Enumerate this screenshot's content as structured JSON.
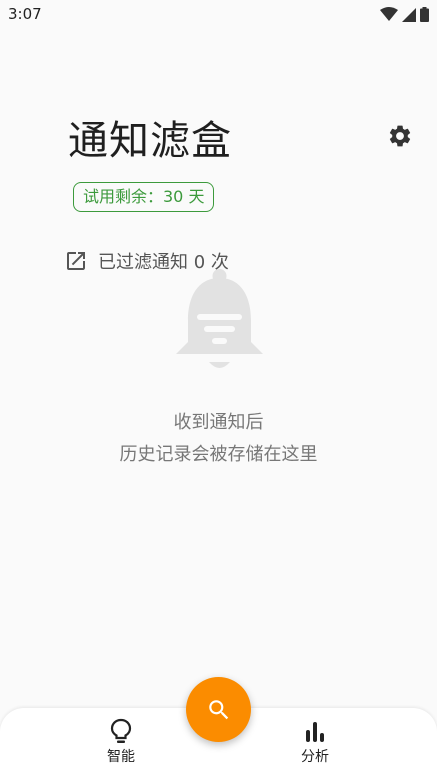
{
  "status_bar": {
    "time": "3:07",
    "icons": [
      "wifi-icon",
      "signal-icon",
      "battery-icon"
    ]
  },
  "header": {
    "title": "通知滤盒",
    "settings_icon": "gear-icon"
  },
  "trial": {
    "label": "试用剩余：30 天",
    "color": "#3c9a3c"
  },
  "filtered": {
    "text": "已过滤通知 0 次",
    "icon": "open-external-icon"
  },
  "empty_state": {
    "icon": "bell-filter-icon",
    "line1": "收到通知后",
    "line2": "历史记录会被存储在这里"
  },
  "bottom_nav": {
    "items": [
      {
        "label": "智能",
        "icon": "lightbulb-icon"
      },
      {
        "label": "分析",
        "icon": "bar-chart-icon"
      }
    ]
  },
  "fab": {
    "icon": "search-icon",
    "color": "#fb8c00"
  }
}
